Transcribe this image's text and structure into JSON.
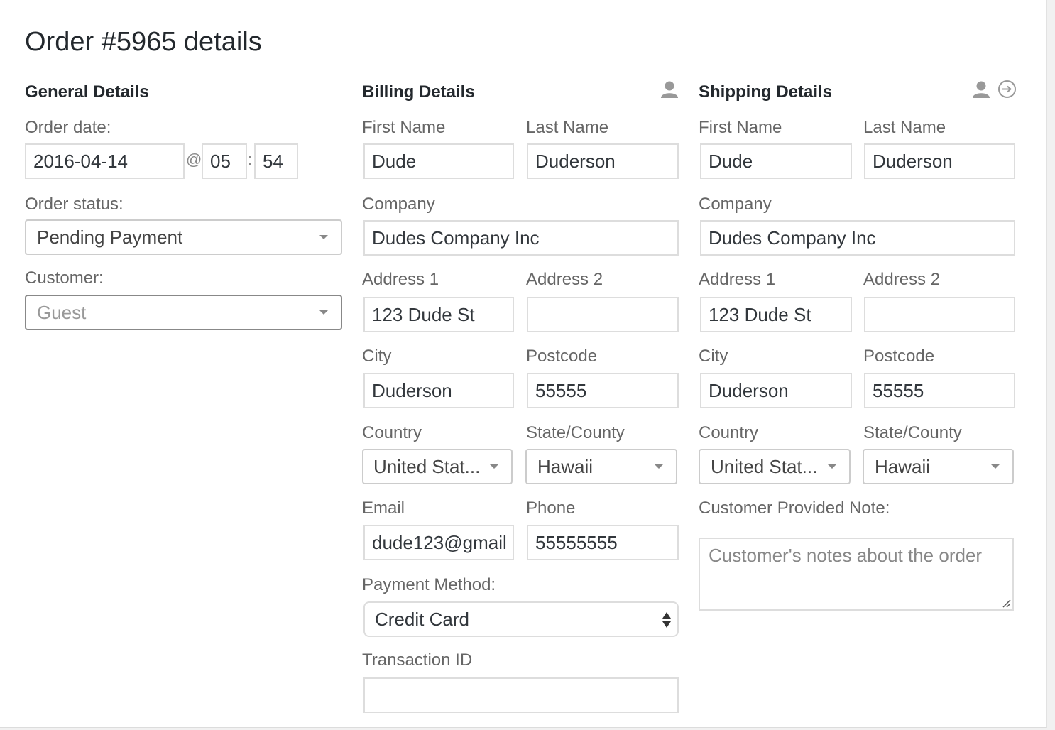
{
  "page_title": "Order #5965 details",
  "general": {
    "heading": "General Details",
    "order_date_label": "Order date:",
    "order_date": "2016-04-14",
    "at_symbol": "@",
    "hour": "05",
    "colon": ":",
    "minute": "54",
    "order_status_label": "Order status:",
    "order_status": "Pending Payment",
    "customer_label": "Customer:",
    "customer_placeholder": "Guest"
  },
  "billing": {
    "heading": "Billing Details",
    "icons": [
      "user-icon"
    ],
    "first_name_label": "First Name",
    "first_name": "Dude",
    "last_name_label": "Last Name",
    "last_name": "Duderson",
    "company_label": "Company",
    "company": "Dudes Company Inc",
    "address1_label": "Address 1",
    "address1": "123 Dude St",
    "address2_label": "Address 2",
    "address2": "",
    "city_label": "City",
    "city": "Duderson",
    "postcode_label": "Postcode",
    "postcode": "55555",
    "country_label": "Country",
    "country": "United Stat...",
    "state_label": "State/County",
    "state": "Hawaii",
    "email_label": "Email",
    "email": "dude123@gmail",
    "phone_label": "Phone",
    "phone": "55555555",
    "payment_method_label": "Payment Method:",
    "payment_method": "Credit Card",
    "transaction_id_label": "Transaction ID",
    "transaction_id": ""
  },
  "shipping": {
    "heading": "Shipping Details",
    "icons": [
      "user-icon",
      "copy-arrow-icon"
    ],
    "first_name_label": "First Name",
    "first_name": "Dude",
    "last_name_label": "Last Name",
    "last_name": "Duderson",
    "company_label": "Company",
    "company": "Dudes Company Inc",
    "address1_label": "Address 1",
    "address1": "123 Dude St",
    "address2_label": "Address 2",
    "address2": "",
    "city_label": "City",
    "city": "Duderson",
    "postcode_label": "Postcode",
    "postcode": "55555",
    "country_label": "Country",
    "country": "United Stat...",
    "state_label": "State/County",
    "state": "Hawaii",
    "note_label": "Customer Provided Note:",
    "note_placeholder": "Customer's notes about the order"
  }
}
